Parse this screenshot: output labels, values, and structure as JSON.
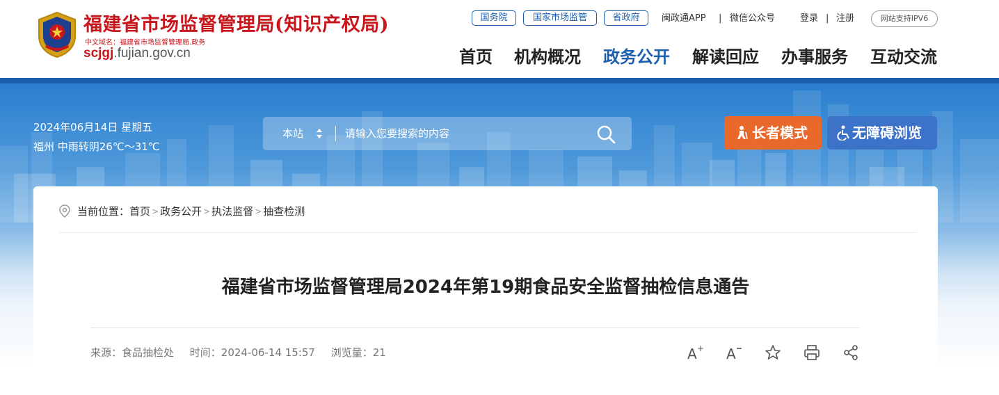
{
  "header": {
    "site_name": "福建省市场监督管理局(知识产权局)",
    "cn_domain": "中文域名：福建省市场监督管理局.政务",
    "domain_main": "scjgj",
    "domain_rest": ".fujian.gov.cn",
    "top_links": {
      "pill_1": "国务院",
      "pill_2": "国家市场监管",
      "pill_3": "省政府",
      "app": "闽政通APP",
      "wechat": "微信公众号",
      "login": "登录",
      "register": "注册",
      "ipv6": "网站支持IPV6"
    },
    "nav": {
      "home": "首页",
      "org": "机构概况",
      "affairs": "政务公开",
      "interpret": "解读回应",
      "services": "办事服务",
      "interact": "互动交流"
    }
  },
  "banner": {
    "date": "2024年06月14日 星期五",
    "weather": "福州 中雨转阴26℃～31℃",
    "search": {
      "scope": "本站",
      "placeholder": "请输入您要搜索的内容"
    },
    "elder_mode": "长者模式",
    "accessible": "无障碍浏览"
  },
  "breadcrumb": {
    "prefix": "当前位置：",
    "items": [
      "首页",
      "政务公开",
      "执法监督",
      "抽查检测"
    ]
  },
  "article": {
    "title": "福建省市场监督管理局2024年第19期食品安全监督抽检信息通告",
    "source": "来源：食品抽检处",
    "time": "时间：2024-06-14 15:57",
    "views": "浏览量：21"
  },
  "colors": {
    "brand_red": "#c8161d",
    "brand_blue": "#1c5fae",
    "elder_orange": "#e9692c",
    "access_blue": "#3c72c8"
  },
  "icons": [
    "emblem-icon",
    "chevron-updown-icon",
    "search-icon",
    "elder-icon",
    "wheelchair-icon",
    "location-pin-icon",
    "font-increase-icon",
    "font-decrease-icon",
    "star-icon",
    "print-icon",
    "share-icon"
  ]
}
